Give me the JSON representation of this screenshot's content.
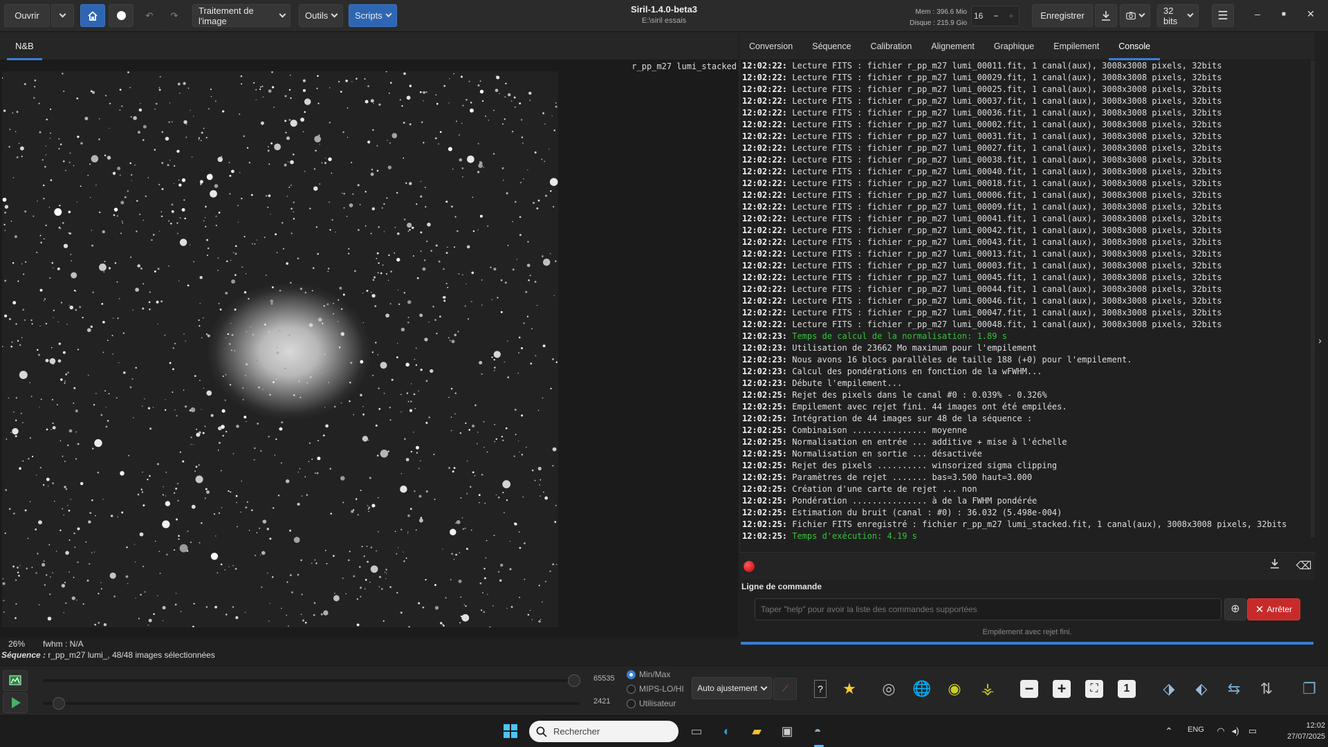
{
  "toolbar": {
    "open_label": "Ouvrir",
    "image_processing_label": "Traitement de l'image",
    "tools_label": "Outils",
    "scripts_label": "Scripts",
    "save_label": "Enregistrer",
    "bitdepth_label": "32 bits"
  },
  "window": {
    "title": "Siril-1.4.0-beta3",
    "path": "E:\\siril essais"
  },
  "memory": {
    "mem": "Mem : 396.6 Mio",
    "disk": "Disque : 215.9 Gio"
  },
  "threads": "16",
  "left_tab": "N&B",
  "image": {
    "label": "r_pp_m27 lumi_stacked",
    "zoom": "26%",
    "fwhm": "fwhm : N/A"
  },
  "sequence_info": {
    "prefix": "Séquence :",
    "text": " r_pp_m27 lumi_, 48/48 images sélectionnées"
  },
  "right_tabs": [
    "Conversion",
    "Séquence",
    "Calibration",
    "Alignement",
    "Graphique",
    "Empilement",
    "Console"
  ],
  "console_lines": [
    {
      "t": "12:02:22:",
      "m": " Lecture FITS : fichier r_pp_m27 lumi_00011.fit, 1 canal(aux), 3008x3008 pixels, 32bits"
    },
    {
      "t": "12:02:22:",
      "m": " Lecture FITS : fichier r_pp_m27 lumi_00029.fit, 1 canal(aux), 3008x3008 pixels, 32bits"
    },
    {
      "t": "12:02:22:",
      "m": " Lecture FITS : fichier r_pp_m27 lumi_00025.fit, 1 canal(aux), 3008x3008 pixels, 32bits"
    },
    {
      "t": "12:02:22:",
      "m": " Lecture FITS : fichier r_pp_m27 lumi_00037.fit, 1 canal(aux), 3008x3008 pixels, 32bits"
    },
    {
      "t": "12:02:22:",
      "m": " Lecture FITS : fichier r_pp_m27 lumi_00036.fit, 1 canal(aux), 3008x3008 pixels, 32bits"
    },
    {
      "t": "12:02:22:",
      "m": " Lecture FITS : fichier r_pp_m27 lumi_00002.fit, 1 canal(aux), 3008x3008 pixels, 32bits"
    },
    {
      "t": "12:02:22:",
      "m": " Lecture FITS : fichier r_pp_m27 lumi_00031.fit, 1 canal(aux), 3008x3008 pixels, 32bits"
    },
    {
      "t": "12:02:22:",
      "m": " Lecture FITS : fichier r_pp_m27 lumi_00027.fit, 1 canal(aux), 3008x3008 pixels, 32bits"
    },
    {
      "t": "12:02:22:",
      "m": " Lecture FITS : fichier r_pp_m27 lumi_00038.fit, 1 canal(aux), 3008x3008 pixels, 32bits"
    },
    {
      "t": "12:02:22:",
      "m": " Lecture FITS : fichier r_pp_m27 lumi_00040.fit, 1 canal(aux), 3008x3008 pixels, 32bits"
    },
    {
      "t": "12:02:22:",
      "m": " Lecture FITS : fichier r_pp_m27 lumi_00018.fit, 1 canal(aux), 3008x3008 pixels, 32bits"
    },
    {
      "t": "12:02:22:",
      "m": " Lecture FITS : fichier r_pp_m27 lumi_00006.fit, 1 canal(aux), 3008x3008 pixels, 32bits"
    },
    {
      "t": "12:02:22:",
      "m": " Lecture FITS : fichier r_pp_m27 lumi_00009.fit, 1 canal(aux), 3008x3008 pixels, 32bits"
    },
    {
      "t": "12:02:22:",
      "m": " Lecture FITS : fichier r_pp_m27 lumi_00041.fit, 1 canal(aux), 3008x3008 pixels, 32bits"
    },
    {
      "t": "12:02:22:",
      "m": " Lecture FITS : fichier r_pp_m27 lumi_00042.fit, 1 canal(aux), 3008x3008 pixels, 32bits"
    },
    {
      "t": "12:02:22:",
      "m": " Lecture FITS : fichier r_pp_m27 lumi_00043.fit, 1 canal(aux), 3008x3008 pixels, 32bits"
    },
    {
      "t": "12:02:22:",
      "m": " Lecture FITS : fichier r_pp_m27 lumi_00013.fit, 1 canal(aux), 3008x3008 pixels, 32bits"
    },
    {
      "t": "12:02:22:",
      "m": " Lecture FITS : fichier r_pp_m27 lumi_00003.fit, 1 canal(aux), 3008x3008 pixels, 32bits"
    },
    {
      "t": "12:02:22:",
      "m": " Lecture FITS : fichier r_pp_m27 lumi_00045.fit, 1 canal(aux), 3008x3008 pixels, 32bits"
    },
    {
      "t": "12:02:22:",
      "m": " Lecture FITS : fichier r_pp_m27 lumi_00044.fit, 1 canal(aux), 3008x3008 pixels, 32bits"
    },
    {
      "t": "12:02:22:",
      "m": " Lecture FITS : fichier r_pp_m27 lumi_00046.fit, 1 canal(aux), 3008x3008 pixels, 32bits"
    },
    {
      "t": "12:02:22:",
      "m": " Lecture FITS : fichier r_pp_m27 lumi_00047.fit, 1 canal(aux), 3008x3008 pixels, 32bits"
    },
    {
      "t": "12:02:22:",
      "m": " Lecture FITS : fichier r_pp_m27 lumi_00048.fit, 1 canal(aux), 3008x3008 pixels, 32bits"
    },
    {
      "t": "12:02:23:",
      "m": " Temps de calcul de la normalisation: 1.89 s",
      "g": true
    },
    {
      "t": "12:02:23:",
      "m": " Utilisation de 23662 Mo maximum pour l'empilement"
    },
    {
      "t": "12:02:23:",
      "m": " Nous avons 16 blocs parallèles de taille 188 (+0) pour l'empilement."
    },
    {
      "t": "12:02:23:",
      "m": " Calcul des pondérations en fonction de la wFWHM..."
    },
    {
      "t": "12:02:23:",
      "m": " Débute l'empilement..."
    },
    {
      "t": "12:02:25:",
      "m": " Rejet des pixels dans le canal #0 : 0.039% - 0.326%"
    },
    {
      "t": "12:02:25:",
      "m": " Empilement avec rejet fini. 44 images ont été empilées."
    },
    {
      "t": "12:02:25:",
      "m": " Intégration de 44 images sur 48 de la séquence :"
    },
    {
      "t": "12:02:25:",
      "m": " Combinaison ............... moyenne"
    },
    {
      "t": "12:02:25:",
      "m": " Normalisation en entrée ... additive + mise à l'échelle"
    },
    {
      "t": "12:02:25:",
      "m": " Normalisation en sortie ... désactivée"
    },
    {
      "t": "12:02:25:",
      "m": " Rejet des pixels .......... winsorized sigma clipping"
    },
    {
      "t": "12:02:25:",
      "m": " Paramètres de rejet ....... bas=3.500 haut=3.000"
    },
    {
      "t": "12:02:25:",
      "m": " Création d'une carte de rejet ... non"
    },
    {
      "t": "12:02:25:",
      "m": " Pondération ............... à de la FWHM pondérée"
    },
    {
      "t": "12:02:25:",
      "m": " Estimation du bruit (canal : #0) : 36.032 (5.498e-004)"
    },
    {
      "t": "12:02:25:",
      "m": " Fichier FITS enregistré : fichier r_pp_m27 lumi_stacked.fit, 1 canal(aux), 3008x3008 pixels, 32bits"
    },
    {
      "t": "12:02:25:",
      "m": " Temps d'exécution: 4.19 s",
      "g": true
    }
  ],
  "command": {
    "label": "Ligne de commande",
    "placeholder": "Taper \"help\" pour avoir la liste des commandes supportées",
    "stop_label": "Arrêter",
    "status": "Empilement avec rejet fini.",
    "progress": 1.0
  },
  "sliders": {
    "high_value": "65535",
    "low_value": "2421",
    "high_fraction": 0.99,
    "low_fraction": 0.03
  },
  "display_mode": {
    "options": [
      "Min/Max",
      "MIPS-LO/HI",
      "Utilisateur"
    ],
    "selected": 0,
    "auto_label": "Auto ajustement"
  },
  "taskbar": {
    "search_label": "Rechercher",
    "lang": "ENG",
    "time": "12:02",
    "date": "27/07/2025"
  },
  "colors": {
    "accent": "#3a7fd5",
    "stop": "#c82a2a",
    "console_green": "#36c23a"
  }
}
